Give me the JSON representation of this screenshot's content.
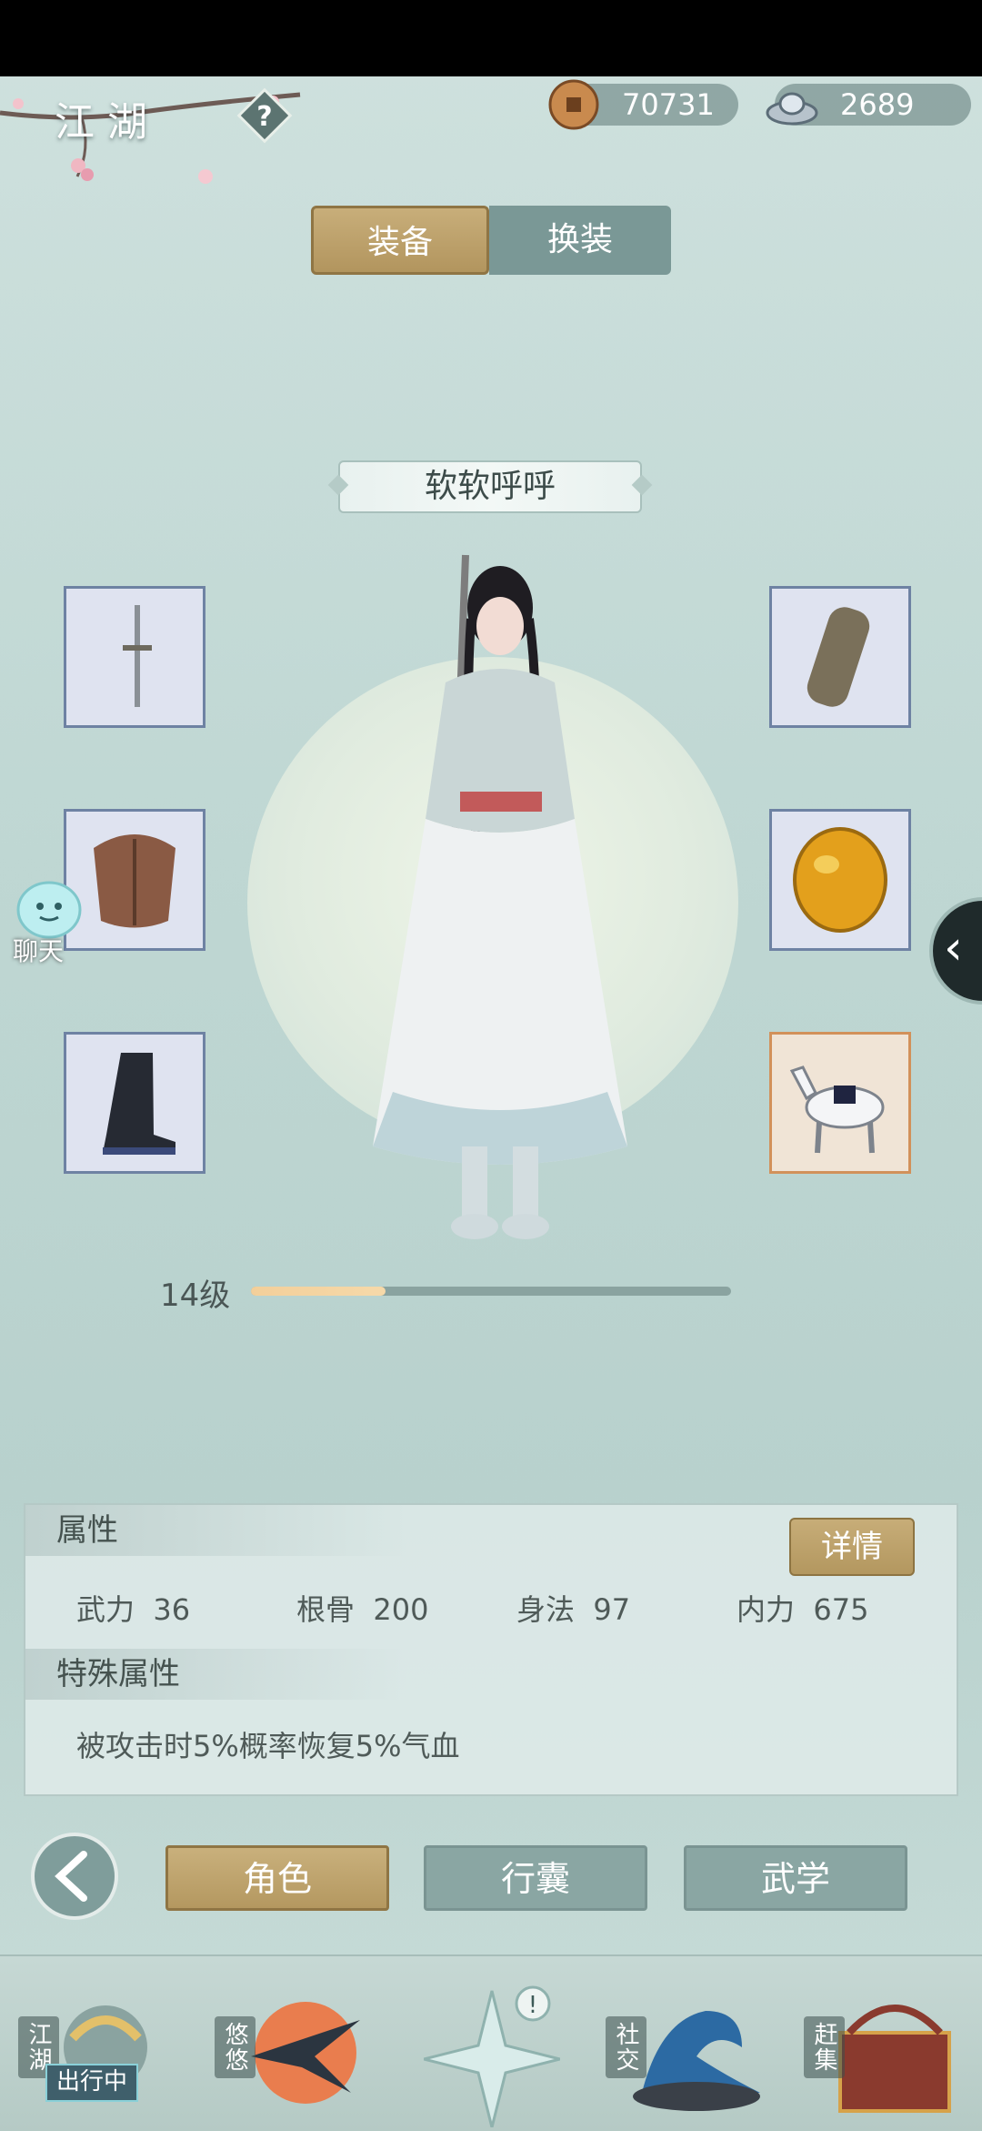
{
  "header": {
    "title": "江湖",
    "help_icon": "question-diamond-icon",
    "currencies": [
      {
        "name": "copper-coin-icon",
        "value": "70731"
      },
      {
        "name": "silver-ingot-icon",
        "value": "2689"
      }
    ]
  },
  "segment": {
    "active": "装备",
    "inactive": "换装"
  },
  "character": {
    "name": "软软呼呼",
    "level_label": "14级",
    "level_progress": 0.28
  },
  "equipment": {
    "left": [
      "sword-icon",
      "armor-icon",
      "boots-icon"
    ],
    "right": [
      "bracer-icon",
      "amber-gem-icon",
      "horse-icon"
    ]
  },
  "side": {
    "chat_label": "聊天",
    "collapse_icon": "chevron-left-icon"
  },
  "attributes": {
    "section_title": "属性",
    "detail_button": "详情",
    "stats": [
      {
        "label": "武力",
        "value": "36"
      },
      {
        "label": "根骨",
        "value": "200"
      },
      {
        "label": "身法",
        "value": "97"
      },
      {
        "label": "内力",
        "value": "675"
      }
    ],
    "special_title": "特殊属性",
    "special_text": "被攻击时5%概率恢复5%气血"
  },
  "tabs": {
    "items": [
      "角色",
      "行囊",
      "武学"
    ],
    "active_index": 0
  },
  "dock": {
    "items": [
      {
        "label": "江湖",
        "tag": "出行中"
      },
      {
        "label": "悠悠"
      },
      {
        "label": ""
      },
      {
        "label": "社交"
      },
      {
        "label": "赶集"
      }
    ],
    "notice_badge": "!"
  },
  "colors": {
    "accent_gold": "#b8995f",
    "panel_teal": "#8aa6a3"
  }
}
